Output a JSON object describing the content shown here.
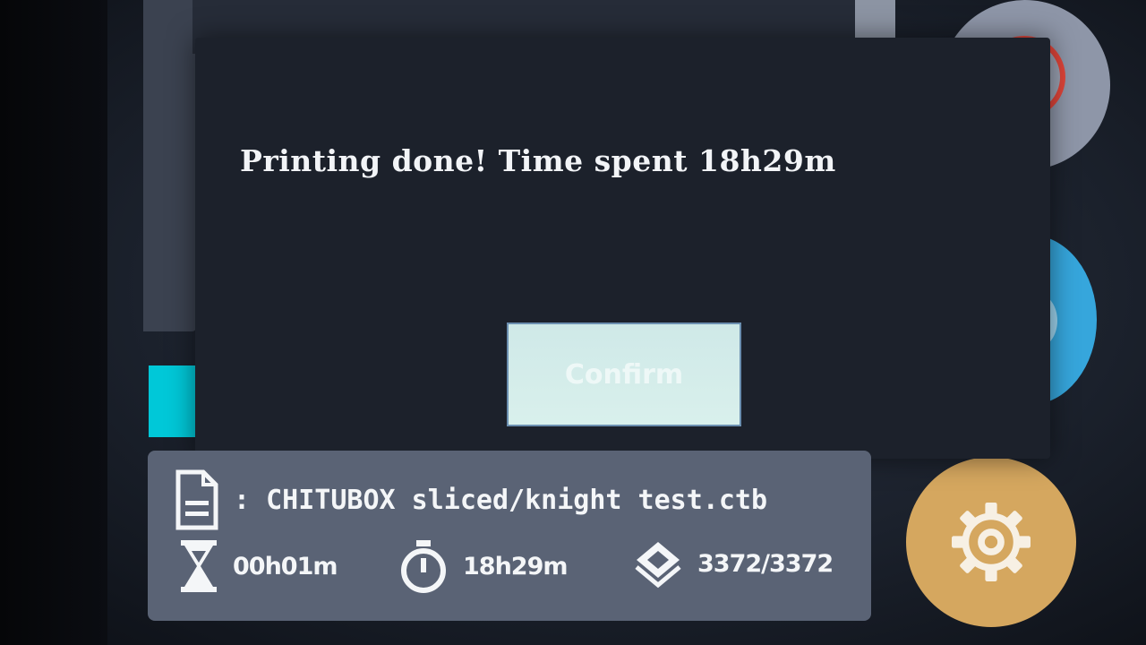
{
  "dialog": {
    "message": "Printing done! Time spent 18h29m",
    "button_label": "Confirm"
  },
  "file": {
    "name": ": CHITUBOX sliced/knight test.ctb"
  },
  "stats": {
    "elapsed": "00h01m",
    "total_time": "18h29m",
    "layers": "3372/3372"
  },
  "side_buttons": {
    "stop": "stop-button",
    "pause": "pause-button",
    "settings": "settings-button"
  },
  "colors": {
    "dialog_bg": "#1c212b",
    "info_panel_bg": "#5a6375",
    "stop_accent": "#e0453a",
    "pause_accent": "#36a6dc",
    "settings_accent": "#d5a75f",
    "status_square": "#00c8d8"
  }
}
